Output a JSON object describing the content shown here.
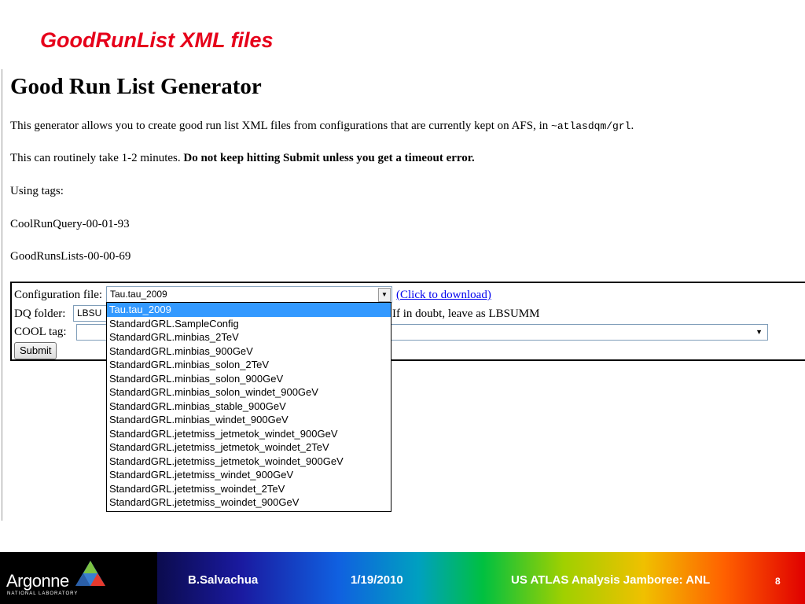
{
  "slide": {
    "title": "GoodRunList XML files"
  },
  "page": {
    "heading": "Good Run List Generator",
    "intro_text": "This generator allows you to create good run list XML files from configurations that are currently kept on AFS, in ",
    "intro_path": "~atlasdqm/grl",
    "intro_end": ".",
    "timing_text": "This can routinely take 1-2 minutes. ",
    "timing_bold": "Do not keep hitting Submit unless you get a timeout error.",
    "tags_label": "Using tags:",
    "tag1": "CoolRunQuery-00-01-93",
    "tag2": "GoodRunsLists-00-00-69"
  },
  "form": {
    "config_label": "Configuration file:",
    "config_value": "Tau.tau_2009",
    "download_link": "(Click to download)",
    "dq_label": "DQ folder:",
    "dq_value": "LBSU",
    "dq_hint": "If in doubt, leave as LBSUMM",
    "cool_label": "COOL tag:",
    "cool_value": "",
    "submit_label": "Submit",
    "options": [
      "Tau.tau_2009",
      "StandardGRL.SampleConfig",
      "StandardGRL.minbias_2TeV",
      "StandardGRL.minbias_900GeV",
      "StandardGRL.minbias_solon_2TeV",
      "StandardGRL.minbias_solon_900GeV",
      "StandardGRL.minbias_solon_windet_900GeV",
      "StandardGRL.minbias_stable_900GeV",
      "StandardGRL.minbias_windet_900GeV",
      "StandardGRL.jetetmiss_jetmetok_windet_900GeV",
      "StandardGRL.jetetmiss_jetmetok_woindet_2TeV",
      "StandardGRL.jetetmiss_jetmetok_woindet_900GeV",
      "StandardGRL.jetetmiss_windet_900GeV",
      "StandardGRL.jetetmiss_woindet_2TeV",
      "StandardGRL.jetetmiss_woindet_900GeV"
    ]
  },
  "footer": {
    "logo_text": "Argonne",
    "logo_sub": "NATIONAL LABORATORY",
    "author": "B.Salvachua",
    "date": "1/19/2010",
    "event": "US ATLAS Analysis Jamboree: ANL",
    "page_number": "8"
  },
  "colors": {
    "title_red": "#e6001a",
    "link_blue": "#0000ee",
    "selection_blue": "#3399ff"
  }
}
